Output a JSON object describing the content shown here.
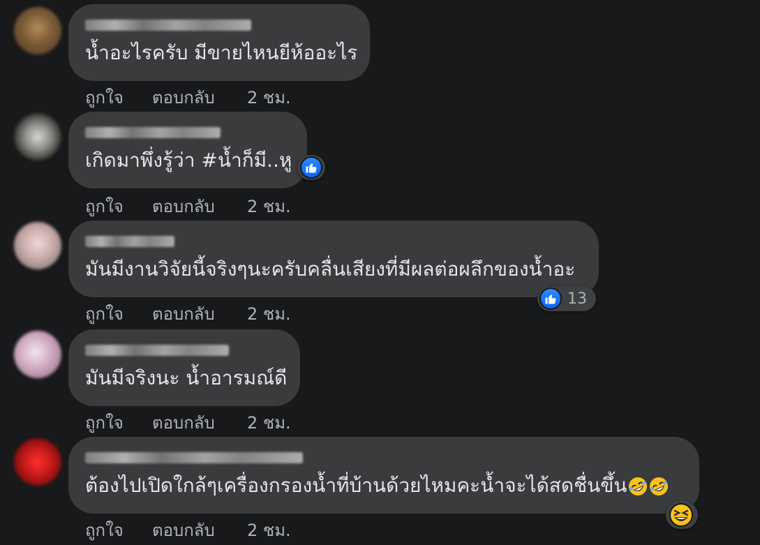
{
  "comments": [
    {
      "text": "น้ำอะไรครับ มีขายไหนยีห้ออะไร",
      "like_label": "ถูกใจ",
      "reply_label": "ตอบกลับ",
      "time": "2 ชม."
    },
    {
      "text": "เกิดมาพึ่งรู้ว่า #น้ำก็มี..หู",
      "like_label": "ถูกใจ",
      "reply_label": "ตอบกลับ",
      "time": "2 ชม."
    },
    {
      "text": "มันมีงานวิจัยนี้จริงๆนะครับคลื่นเสียงที่มีผลต่อผลึกของน้ำอะ",
      "reaction_count": "13",
      "like_label": "ถูกใจ",
      "reply_label": "ตอบกลับ",
      "time": "2 ชม."
    },
    {
      "text": "มันมีจริงนะ น้ำอารมณ์ดี",
      "like_label": "ถูกใจ",
      "reply_label": "ตอบกลับ",
      "time": "2 ชม."
    },
    {
      "text": "ต้องไปเปิดใกล้ๆเครื่องกรองน้ำที่บ้านด้วยไหมคะน้ำจะได้สดชื่นขึ้น",
      "like_label": "ถูกใจ",
      "reply_label": "ตอบกลับ",
      "time": "2 ชม."
    }
  ],
  "colors": {
    "background": "#18191a",
    "bubble": "#3a3b3c",
    "text": "#e4e6eb",
    "secondary_text": "#b0b3b8",
    "like_blue": "#0866ff"
  },
  "icons": {
    "like_reaction": "thumbs-up-icon",
    "laugh_reaction": "rolling-laughing-emoji",
    "grin_reaction": "squinting-grin-emoji"
  }
}
